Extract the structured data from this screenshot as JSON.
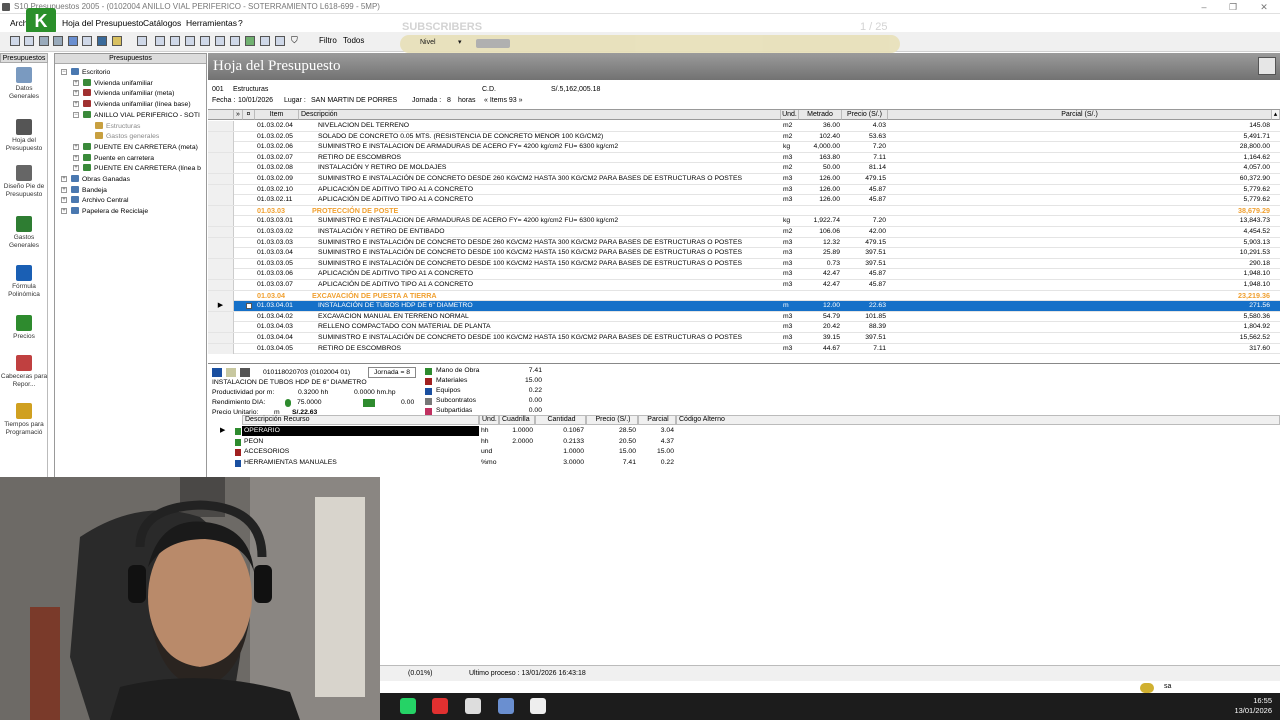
{
  "window": {
    "title": "S10 Presupuestos 2005 - (0102004 ANILLO VIAL PERIFERICO - SOTERRAMIENTO L618-699 - 5MP)",
    "logo_letter": "K"
  },
  "menu": {
    "items": [
      "Archivo",
      "Hoja del Presupuesto",
      "Catálogos",
      "Herramientas",
      "?"
    ]
  },
  "toolbar": {
    "filter_label": "Filtro",
    "filter_value": "Todos",
    "level_label": "Nivel",
    "overlay_text": "SUBSCRIBERS",
    "overlay_counter": "1 / 25"
  },
  "leftnav": {
    "header": "Presupuestos",
    "items": [
      {
        "label": "Datos Generales",
        "icon": "diamond-icon",
        "color": "#7a9ac0"
      },
      {
        "label": "Hoja del Presupuesto",
        "icon": "worker-icon",
        "color": "#555555"
      },
      {
        "label": "Diseño Pie de Presupuesto",
        "icon": "edit-document-icon",
        "color": "#666666"
      },
      {
        "label": "Gastos Generales",
        "icon": "books-icon",
        "color": "#2e7d32"
      },
      {
        "label": "Fórmula Polinómica",
        "icon": "function-icon",
        "color": "#1a5fb4"
      },
      {
        "label": "Precios",
        "icon": "money-icon",
        "color": "#2e8b2e"
      },
      {
        "label": "Cabeceras para Repor...",
        "icon": "note-icon",
        "color": "#c04040"
      },
      {
        "label": "Tiempos para Programació",
        "icon": "stopwatch-icon",
        "color": "#d0a020"
      }
    ]
  },
  "tree": {
    "header": "Presupuestos",
    "nodes": [
      {
        "label": "Escritorio",
        "level": 0,
        "color": "#4a78b0"
      },
      {
        "label": "Vivienda unifamiliar",
        "level": 1,
        "color": "#3a8a3a"
      },
      {
        "label": "Vivienda unifamiliar (meta)",
        "level": 1,
        "color": "#a03030"
      },
      {
        "label": "Vivienda unifamiliar (línea base)",
        "level": 1,
        "color": "#a03030"
      },
      {
        "label": "ANILLO VIAL PERIFERICO - SOTI",
        "level": 1,
        "color": "#3a8a3a"
      },
      {
        "label": "Estructuras",
        "level": 2,
        "color": "#c8a040"
      },
      {
        "label": "Gastos generales",
        "level": 2,
        "color": "#c8a040"
      },
      {
        "label": "PUENTE EN CARRETERA (meta)",
        "level": 1,
        "color": "#3a8a3a"
      },
      {
        "label": "Puente en carretera",
        "level": 1,
        "color": "#3a8a3a"
      },
      {
        "label": "PUENTE EN CARRETERA (línea b",
        "level": 1,
        "color": "#3a8a3a"
      },
      {
        "label": "Obras Ganadas",
        "level": 0,
        "color": "#4a78b0"
      },
      {
        "label": "Bandeja",
        "level": 0,
        "color": "#4a78b0"
      },
      {
        "label": "Archivo Central",
        "level": 0,
        "color": "#4a78b0"
      },
      {
        "label": "Papelera de Reciclaje",
        "level": 0,
        "color": "#4a78b0"
      }
    ]
  },
  "sheet": {
    "title": "Hoja del Presupuesto",
    "code": "001",
    "name": "Estructuras",
    "cd_label": "C.D.",
    "cd_value": "S/.5,162,005.18",
    "fecha_label": "Fecha :",
    "fecha": "10/01/2026",
    "lugar_label": "Lugar :",
    "lugar": "SAN MARTIN DE PORRES",
    "jornada_label": "Jornada :",
    "jornada": "8",
    "horas_label": "horas",
    "items_label": "« Items 93 »"
  },
  "grid": {
    "headers": [
      "»",
      "¤",
      "Item",
      "Descripción",
      "Und.",
      "Metrado",
      "Precio (S/.)",
      "Parcial (S/.)"
    ],
    "rows": [
      {
        "item": "01.03.02.04",
        "desc": "NIVELACION DEL TERRENO",
        "und": "m2",
        "metrado": "36.00",
        "precio": "4.03",
        "parcial": "145.08"
      },
      {
        "item": "01.03.02.05",
        "desc": "SOLADO DE CONCRETO 0.05 MTS. (RESISTENCIA DE CONCRETO MENOR 100 KG/CM2)",
        "und": "m2",
        "metrado": "102.40",
        "precio": "53.63",
        "parcial": "5,491.71"
      },
      {
        "item": "01.03.02.06",
        "desc": "SUMINISTRO E INSTALACION DE ARMADURAS DE ACERO FY= 4200 kg/cm2 FU= 6300 kg/cm2",
        "und": "kg",
        "metrado": "4,000.00",
        "precio": "7.20",
        "parcial": "28,800.00"
      },
      {
        "item": "01.03.02.07",
        "desc": "RETIRO DE ESCOMBROS",
        "und": "m3",
        "metrado": "163.80",
        "precio": "7.11",
        "parcial": "1,164.62"
      },
      {
        "item": "01.03.02.08",
        "desc": "INSTALACIÓN Y RETIRO DE MOLDAJES",
        "und": "m2",
        "metrado": "50.00",
        "precio": "81.14",
        "parcial": "4,057.00"
      },
      {
        "item": "01.03.02.09",
        "desc": "SUMINISTRO E INSTALACIÓN DE CONCRETO DESDE 260 KG/CM2 HASTA 300 KG/CM2 PARA BASES DE ESTRUCTURAS O POSTES",
        "und": "m3",
        "metrado": "126.00",
        "precio": "479.15",
        "parcial": "60,372.90"
      },
      {
        "item": "01.03.02.10",
        "desc": "APLICACIÓN DE ADITIVO TIPO A1 A CONCRETO",
        "und": "m3",
        "metrado": "126.00",
        "precio": "45.87",
        "parcial": "5,779.62"
      },
      {
        "item": "01.03.02.11",
        "desc": "APLICACIÓN DE ADITIVO TIPO A1 A CONCRETO",
        "und": "m3",
        "metrado": "126.00",
        "precio": "45.87",
        "parcial": "5,779.62"
      },
      {
        "item": "01.03.03",
        "desc": "PROTECCIÓN DE POSTE",
        "und": "",
        "metrado": "",
        "precio": "",
        "parcial": "38,679.29",
        "type": "cap"
      },
      {
        "item": "01.03.03.01",
        "desc": "SUMINISTRO E INSTALACION DE ARMADURAS DE ACERO FY= 4200 kg/cm2 FU= 6300 kg/cm2",
        "und": "kg",
        "metrado": "1,922.74",
        "precio": "7.20",
        "parcial": "13,843.73"
      },
      {
        "item": "01.03.03.02",
        "desc": "INSTALACIÓN Y RETIRO DE ENTIBADO",
        "und": "m2",
        "metrado": "106.06",
        "precio": "42.00",
        "parcial": "4,454.52"
      },
      {
        "item": "01.03.03.03",
        "desc": "SUMINISTRO E INSTALACIÓN DE CONCRETO DESDE 260 KG/CM2 HASTA 300 KG/CM2 PARA BASES DE ESTRUCTURAS O POSTES",
        "und": "m3",
        "metrado": "12.32",
        "precio": "479.15",
        "parcial": "5,903.13"
      },
      {
        "item": "01.03.03.04",
        "desc": "SUMINISTRO E INSTALACIÓN DE CONCRETO DESDE 100 KG/CM2 HASTA 150 KG/CM2 PARA BASES DE ESTRUCTURAS O POSTES",
        "und": "m3",
        "metrado": "25.89",
        "precio": "397.51",
        "parcial": "10,291.53"
      },
      {
        "item": "01.03.03.05",
        "desc": "SUMINISTRO E INSTALACIÓN DE CONCRETO DESDE 100 KG/CM2 HASTA 150 KG/CM2 PARA BASES DE ESTRUCTURAS O POSTES",
        "und": "m3",
        "metrado": "0.73",
        "precio": "397.51",
        "parcial": "290.18"
      },
      {
        "item": "01.03.03.06",
        "desc": "APLICACIÓN DE ADITIVO TIPO A1 A CONCRETO",
        "und": "m3",
        "metrado": "42.47",
        "precio": "45.87",
        "parcial": "1,948.10"
      },
      {
        "item": "01.03.03.07",
        "desc": "APLICACIÓN DE ADITIVO TIPO A1 A CONCRETO",
        "und": "m3",
        "metrado": "42.47",
        "precio": "45.87",
        "parcial": "1,948.10"
      },
      {
        "item": "01.03.04",
        "desc": "EXCAVACIÓN DE PUESTA A TIERRA",
        "und": "",
        "metrado": "",
        "precio": "",
        "parcial": "23,219.36",
        "type": "cap"
      },
      {
        "item": "01.03.04.01",
        "desc": "INSTALACIÓN DE TUBOS HDP DE 6\" DIAMETRO",
        "und": "m",
        "metrado": "12.00",
        "precio": "22.63",
        "parcial": "271.56",
        "type": "sel"
      },
      {
        "item": "01.03.04.02",
        "desc": "EXCAVACION MANUAL EN TERRENO NORMAL",
        "und": "m3",
        "metrado": "54.79",
        "precio": "101.85",
        "parcial": "5,580.36"
      },
      {
        "item": "01.03.04.03",
        "desc": "RELLENO COMPACTADO CON MATERIAL DE PLANTA",
        "und": "m3",
        "metrado": "20.42",
        "precio": "88.39",
        "parcial": "1,804.92"
      },
      {
        "item": "01.03.04.04",
        "desc": "SUMINISTRO E INSTALACIÓN DE CONCRETO DESDE 100 KG/CM2 HASTA 150 KG/CM2 PARA BASES DE ESTRUCTURAS O POSTES",
        "und": "m3",
        "metrado": "39.15",
        "precio": "397.51",
        "parcial": "15,562.52"
      },
      {
        "item": "01.03.04.05",
        "desc": "RETIRO DE ESCOMBROS",
        "und": "m3",
        "metrado": "44.67",
        "precio": "7.11",
        "parcial": "317.60"
      }
    ]
  },
  "detail": {
    "code": "010118020703 (0102004 01)",
    "jornada": "Jornada = 8",
    "desc": "INSTALACION DE TUBOS HDP DE 6\" DIAMETRO",
    "productividad_label": "Productividad por m:",
    "productividad_hh": "0.3200 hh",
    "productividad_hmhp": "0.0000 hm.hp",
    "rendimiento_label": "Rendimiento DIA:",
    "rendimiento_value": "75.0000",
    "rendimiento_extra": "0.00",
    "precio_label": "Precio Unitario:",
    "precio_und": "m",
    "precio_value": "S/.22.63",
    "costs": [
      {
        "label": "Mano de Obra",
        "value": "7.41",
        "color": "#2e8b2e"
      },
      {
        "label": "Materiales",
        "value": "15.00",
        "color": "#a02020"
      },
      {
        "label": "Equipos",
        "value": "0.22",
        "color": "#1a4fa0"
      },
      {
        "label": "Subcontratos",
        "value": "0.00",
        "color": "#777777"
      },
      {
        "label": "Subpartidas",
        "value": "0.00",
        "color": "#c03060"
      }
    ]
  },
  "resources": {
    "headers": [
      "Descripción Recurso",
      "Und.",
      "Cuadrilla",
      "Cantidad",
      "Precio (S/.)",
      "Parcial",
      "Código Alterno"
    ],
    "rows": [
      {
        "desc": "OPERARIO",
        "und": "hh",
        "cuadrilla": "1.0000",
        "cantidad": "0.1067",
        "precio": "28.50",
        "parcial": "3.04",
        "color": "#2e8b2e",
        "sel": true
      },
      {
        "desc": "PEON",
        "und": "hh",
        "cuadrilla": "2.0000",
        "cantidad": "0.2133",
        "precio": "20.50",
        "parcial": "4.37",
        "color": "#2e8b2e"
      },
      {
        "desc": "ACCESORIOS",
        "und": "und",
        "cuadrilla": "",
        "cantidad": "1.0000",
        "precio": "15.00",
        "parcial": "15.00",
        "color": "#a02020"
      },
      {
        "desc": "HERRAMIENTAS MANUALES",
        "und": "%mo",
        "cuadrilla": "",
        "cantidad": "3.0000",
        "precio": "7.41",
        "parcial": "0.22",
        "color": "#1a4fa0"
      }
    ]
  },
  "status": {
    "percent": "(0.01%)",
    "last_process": "Ultimo proceso : 13/01/2026 16:43:18"
  },
  "taskbar": {
    "time": "16:55",
    "date": "13/01/2026",
    "tray_label": "sa",
    "apps": [
      {
        "icon": "whatsapp-icon",
        "color": "#25d366"
      },
      {
        "icon": "pdf-icon",
        "color": "#e03030"
      },
      {
        "icon": "browser-icon",
        "color": "#dddddd"
      },
      {
        "icon": "calculator-icon",
        "color": "#6a8fd0"
      },
      {
        "icon": "app-icon",
        "color": "#eeeeee"
      }
    ]
  }
}
